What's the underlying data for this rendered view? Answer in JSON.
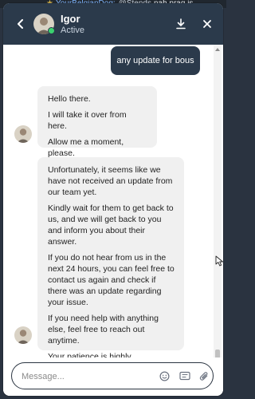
{
  "background": {
    "username": "YourBelgianDog:",
    "mention": "@Stends",
    "text": "nah prag is"
  },
  "header": {
    "agent_name": "Igor",
    "agent_status": "Active",
    "back_icon": "back-arrow-icon",
    "download_icon": "download-icon",
    "close_icon": "close-icon"
  },
  "messages": {
    "user_message": "any update for bous",
    "agent_block_1": [
      "Hello there.",
      "I will take it over from here.",
      "Allow me a moment, please."
    ],
    "agent_block_2": [
      "Unfortunately, it seems like we have not received an update from our team yet.",
      "Kindly wait for them to get back to us, and we will get back to you and inform you about their answer.",
      "If you do not hear from us in the next 24 hours, you can feel free to contact us again and check if there was an update regarding your issue.",
      "If you need help with anything else, feel free to reach out anytime.",
      "Your patience is highly appreciated."
    ]
  },
  "composer": {
    "placeholder": "Message...",
    "icons": [
      "emoji-icon",
      "gif-icon",
      "paperclip-icon"
    ]
  },
  "colors": {
    "header_bg": "#2b3a4b",
    "user_bubble": "#2b3a4b",
    "agent_bubble": "#f0f0f0",
    "status_online": "#3bd16f"
  }
}
